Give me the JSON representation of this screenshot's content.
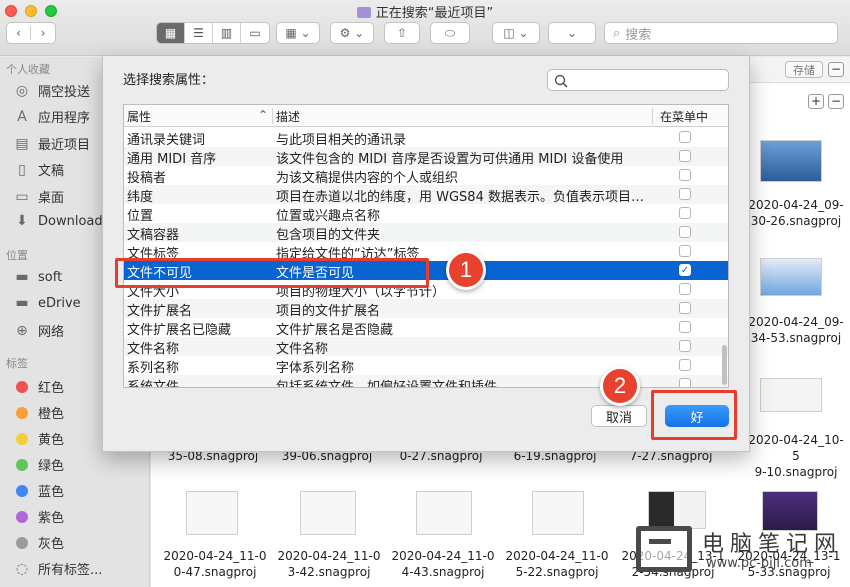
{
  "window": {
    "title": "正在搜索“最近项目”",
    "search_placeholder": "搜索"
  },
  "sidebar": {
    "favorites_header": "个人收藏",
    "favorites": [
      {
        "label": "隔空投送",
        "icon": "airdrop-icon"
      },
      {
        "label": "应用程序",
        "icon": "applications-icon"
      },
      {
        "label": "最近项目",
        "icon": "recents-icon"
      },
      {
        "label": "文稿",
        "icon": "documents-icon"
      },
      {
        "label": "桌面",
        "icon": "desktop-icon"
      },
      {
        "label": "Downloads",
        "icon": "downloads-icon"
      }
    ],
    "locations_header": "位置",
    "locations": [
      {
        "label": "soft",
        "icon": "disk-icon"
      },
      {
        "label": "eDrive",
        "icon": "disk-icon"
      },
      {
        "label": "网络",
        "icon": "network-icon"
      }
    ],
    "tags_header": "标签",
    "tags": [
      {
        "label": "红色",
        "color": "#f0524f"
      },
      {
        "label": "橙色",
        "color": "#f7a035"
      },
      {
        "label": "黄色",
        "color": "#f6cd3a"
      },
      {
        "label": "绿色",
        "color": "#5fc65a"
      },
      {
        "label": "蓝色",
        "color": "#3d88f5"
      },
      {
        "label": "紫色",
        "color": "#b266d8"
      },
      {
        "label": "灰色",
        "color": "#9b9b9d"
      }
    ],
    "all_tags": "所有标签..."
  },
  "content": {
    "save_button": "存储",
    "files_row1": [
      {
        "line1": "35-08.snagproj"
      },
      {
        "line1": "39-06.snagproj"
      },
      {
        "line1": "0-27.snagproj"
      },
      {
        "line1": "6-19.snagproj"
      },
      {
        "line1": "7-27.snagproj"
      }
    ],
    "files_row2": [
      {
        "line1": "2020-04-24_11-0",
        "line2": "0-47.snagproj"
      },
      {
        "line1": "2020-04-24_11-0",
        "line2": "3-42.snagproj"
      },
      {
        "line1": "2020-04-24_11-0",
        "line2": "4-43.snagproj"
      },
      {
        "line1": "2020-04-24_11-0",
        "line2": "5-22.snagproj"
      },
      {
        "line1": "2020-04-24_13-1",
        "line2": "2-54.snagproj"
      },
      {
        "line1": "2020-04-24_13-1",
        "line2": "5-33.snagproj"
      }
    ],
    "files_right": [
      {
        "line1": "2020-04-24_09-",
        "line2": "30-26.snagproj"
      },
      {
        "line1": "2020-04-24_09-",
        "line2": "34-53.snagproj"
      },
      {
        "line1": "2020-04-24_10-5",
        "line2": "9-10.snagproj"
      }
    ]
  },
  "dialog": {
    "title": "选择搜索属性：",
    "columns": {
      "attribute": "属性",
      "description": "描述",
      "in_menu": "在菜单中"
    },
    "rows": [
      {
        "attr": "通讯录关键词",
        "desc": "与此项目相关的通讯录",
        "checked": false
      },
      {
        "attr": "通用 MIDI 音序",
        "desc": "该文件包含的 MIDI 音序是否设置为可供通用 MIDI 设备使用",
        "checked": false
      },
      {
        "attr": "投稿者",
        "desc": "为该文稿提供内容的个人或组织",
        "checked": false
      },
      {
        "attr": "纬度",
        "desc": "项目在赤道以北的纬度，用 WGS84 数据表示。负值表示项目…",
        "checked": false
      },
      {
        "attr": "位置",
        "desc": "位置或兴趣点名称",
        "checked": false
      },
      {
        "attr": "文稿容器",
        "desc": "包含项目的文件夹",
        "checked": false
      },
      {
        "attr": "文件标签",
        "desc": "指定给文件的“访达”标签",
        "checked": false
      },
      {
        "attr": "文件不可见",
        "desc": "文件是否可见",
        "checked": true
      },
      {
        "attr": "文件大小",
        "desc": "项目的物理大小（以字节计）",
        "checked": false
      },
      {
        "attr": "文件扩展名",
        "desc": "项目的文件扩展名",
        "checked": false
      },
      {
        "attr": "文件扩展名已隐藏",
        "desc": "文件扩展名是否隐藏",
        "checked": false
      },
      {
        "attr": "文件名称",
        "desc": "文件名称",
        "checked": false
      },
      {
        "attr": "系列名称",
        "desc": "字体系列名称",
        "checked": false
      },
      {
        "attr": "系统文件",
        "desc": "包括系统文件，如偏好设置文件和插件",
        "checked": false
      }
    ],
    "selected_index": 7,
    "cancel_button": "取消",
    "ok_button": "好"
  },
  "annotations": {
    "badge1": "1",
    "badge2": "2",
    "highlight_color": "#e83c2c"
  },
  "watermark": {
    "title": "电脑笔记网",
    "url": "www.pc-bijl.com"
  }
}
